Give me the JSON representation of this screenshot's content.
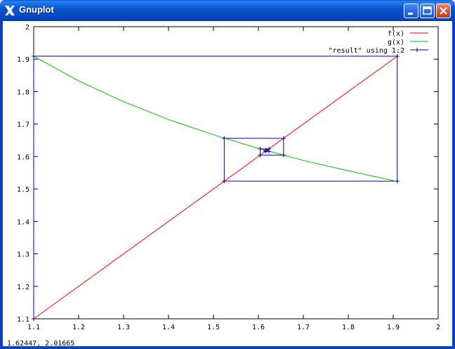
{
  "window": {
    "title": "Gnuplot"
  },
  "statusbar": {
    "coords": "1.62447,  2.01665"
  },
  "colors": {
    "f": "#ff0000",
    "g": "#00c000",
    "result": "#0000a0",
    "border": "#000000"
  },
  "icons": {
    "app": "x-logo-icon",
    "minimize": "minimize-icon",
    "maximize": "maximize-icon",
    "close": "close-icon"
  },
  "chart_data": {
    "type": "line",
    "xlim": [
      1.1,
      2
    ],
    "ylim": [
      1.1,
      2
    ],
    "xticks": [
      1.1,
      1.2,
      1.3,
      1.4,
      1.5,
      1.6,
      1.7,
      1.8,
      1.9,
      2
    ],
    "yticks": [
      1.1,
      1.2,
      1.3,
      1.4,
      1.5,
      1.6,
      1.7,
      1.8,
      1.9,
      2
    ],
    "xticklabels": [
      "1.1",
      "1.2",
      "1.3",
      "1.4",
      "1.5",
      "1.6",
      "1.7",
      "1.8",
      "1.9",
      "2"
    ],
    "yticklabels": [
      "1.1",
      "1.2",
      "1.3",
      "1.4",
      "1.5",
      "1.6",
      "1.7",
      "1.8",
      "1.9",
      "2"
    ],
    "legend_position": "top-right",
    "series": [
      {
        "name": "f(x)",
        "kind": "function",
        "x_range": [
          1.1,
          1.91
        ],
        "y_range": [
          1.1,
          1.91
        ]
      },
      {
        "name": "g(x)",
        "kind": "function",
        "x": [
          1.1,
          1.2,
          1.3,
          1.4,
          1.5,
          1.6,
          1.7,
          1.8,
          1.9
        ],
        "y": [
          1.909,
          1.833,
          1.769,
          1.714,
          1.667,
          1.625,
          1.588,
          1.556,
          1.526
        ]
      },
      {
        "name": "\"result\" using 1:2",
        "kind": "points-lines",
        "x": [
          1.1,
          1.1,
          1.909,
          1.909,
          1.524,
          1.524,
          1.656,
          1.656,
          1.604,
          1.604,
          1.6235,
          1.6235,
          1.616,
          1.616,
          1.619
        ],
        "y": [
          1.1,
          1.909,
          1.909,
          1.524,
          1.524,
          1.656,
          1.656,
          1.604,
          1.604,
          1.6235,
          1.6235,
          1.616,
          1.616,
          1.619,
          1.619
        ]
      }
    ]
  }
}
